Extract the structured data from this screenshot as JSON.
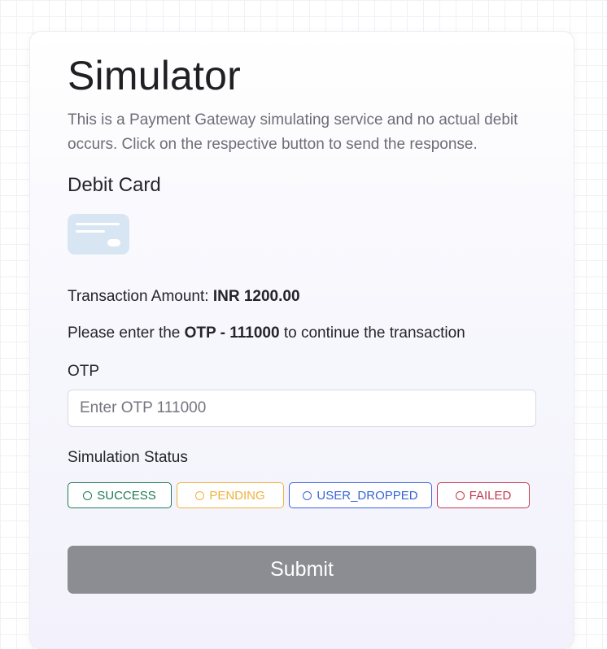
{
  "page": {
    "title": "Simulator",
    "description": "This is a Payment Gateway simulating service and no actual debit occurs. Click on the respective button to send the response."
  },
  "payment_method": {
    "heading": "Debit Card",
    "icon": "credit-card-icon"
  },
  "transaction": {
    "amount_label": "Transaction Amount: ",
    "amount_value": "INR 1200.00",
    "otp_prefix": "Please enter the ",
    "otp_value": "OTP - 111000",
    "otp_suffix": " to continue the transaction"
  },
  "otp_field": {
    "label": "OTP",
    "placeholder": "Enter OTP 111000",
    "value": ""
  },
  "simulation": {
    "label": "Simulation Status",
    "options": [
      {
        "label": "SUCCESS",
        "color": "#1f7a55"
      },
      {
        "label": "PENDING",
        "color": "#f0b33c"
      },
      {
        "label": "USER_DROPPED",
        "color": "#3a64d8"
      },
      {
        "label": "FAILED",
        "color": "#c33a4e"
      }
    ]
  },
  "submit": {
    "label": "Submit",
    "color": "#8c8d92"
  }
}
